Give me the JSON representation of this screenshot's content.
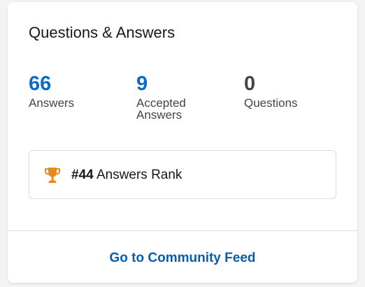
{
  "card": {
    "title": "Questions & Answers"
  },
  "stats": [
    {
      "value": "66",
      "label": "Answers",
      "color": "#0b6bcb"
    },
    {
      "value": "9",
      "label": "Accepted Answers",
      "color": "#0b6bcb"
    },
    {
      "value": "0",
      "label": "Questions",
      "color": "#444444"
    }
  ],
  "rank": {
    "icon": "trophy-icon",
    "icon_color": "#e8891c",
    "number": "#44",
    "label": "Answers Rank"
  },
  "footer": {
    "link_label": "Go to Community Feed"
  }
}
